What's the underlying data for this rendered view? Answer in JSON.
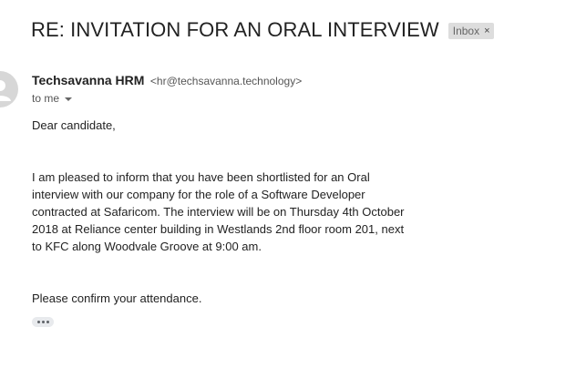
{
  "email": {
    "subject": "RE: INVITATION FOR AN ORAL INTERVIEW",
    "label": {
      "text": "Inbox",
      "remove_glyph": "×"
    },
    "sender": {
      "name": "Techsavanna HRM",
      "email": "<hr@techsavanna.technology>",
      "avatar_icon": "person-icon"
    },
    "recipient": {
      "text": "to me"
    },
    "body": {
      "greeting": "Dear candidate,",
      "lines": [
        "I am pleased to inform that you have been shortlisted for an Oral",
        "interview with our company for the role of a Software Developer",
        "contracted at Safaricom. The interview will be on Thursday 4th October",
        "2018 at Reliance center building in Westlands 2nd floor room 201, next",
        "to KFC along Woodvale Groove at 9:00 am."
      ],
      "closing": "Please confirm your attendance."
    },
    "trimmed_content_icon": "ellipsis-icon"
  }
}
